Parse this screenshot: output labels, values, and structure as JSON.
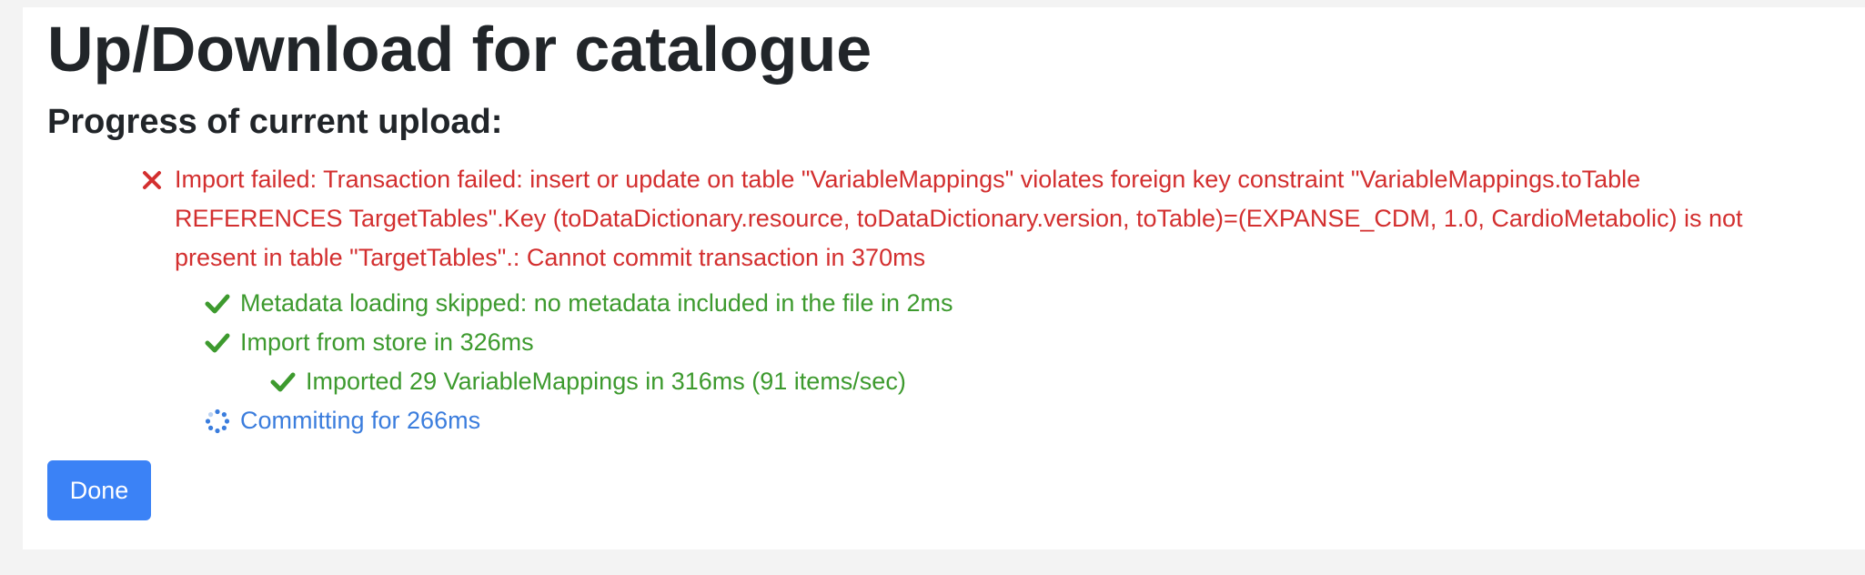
{
  "page": {
    "title": "Up/Download for catalogue"
  },
  "progress": {
    "heading": "Progress of current upload:",
    "steps": [
      {
        "status": "error",
        "icon": "x-icon",
        "text": "Import failed: Transaction failed: insert or update on table \"VariableMappings\" violates foreign key constraint \"VariableMappings.toTable REFERENCES TargetTables\".Key (toDataDictionary.resource, toDataDictionary.version, toTable)=(EXPANSE_CDM, 1.0, CardioMetabolic) is not present in table \"TargetTables\".: Cannot commit transaction in 370ms"
      },
      {
        "status": "success",
        "icon": "check-icon",
        "text": "Metadata loading skipped: no metadata included in the file in 2ms"
      },
      {
        "status": "success",
        "icon": "check-icon",
        "text": "Import from store in 326ms"
      },
      {
        "status": "success",
        "icon": "check-icon",
        "text": "Imported 29 VariableMappings in 316ms (91 items/sec)"
      },
      {
        "status": "running",
        "icon": "spinner-icon",
        "text": "Committing for 266ms"
      }
    ]
  },
  "actions": {
    "done_label": "Done"
  },
  "colors": {
    "error": "#d32f2f",
    "success": "#3d9a2e",
    "running": "#3b7ddd",
    "primary_button": "#3b82f6"
  }
}
